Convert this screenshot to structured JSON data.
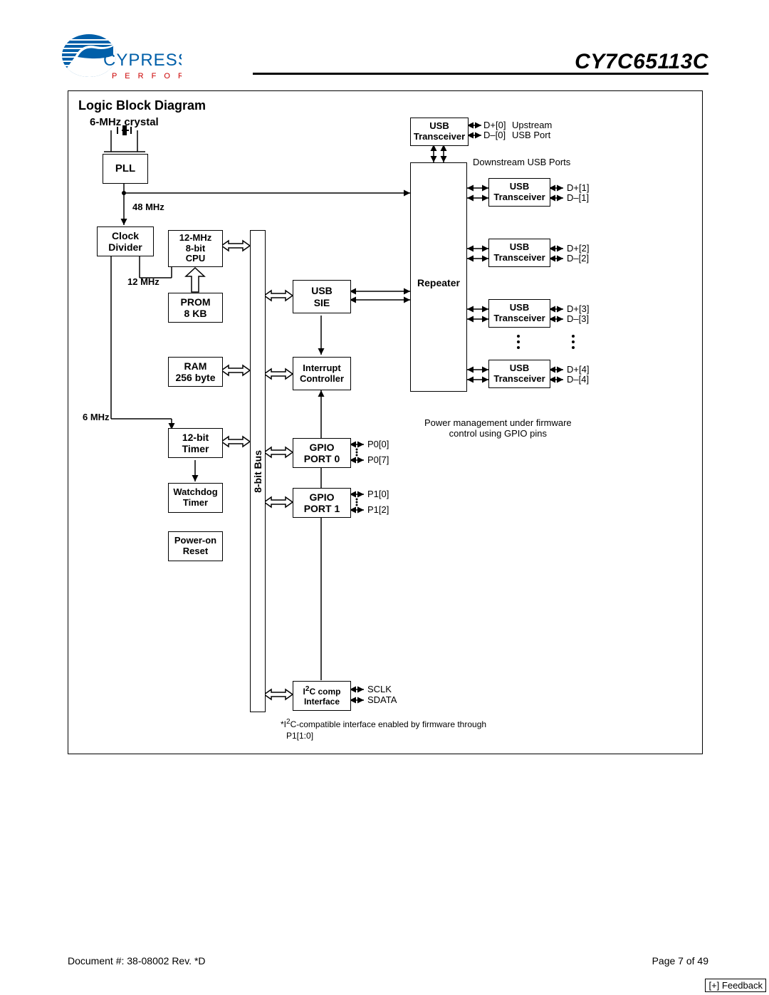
{
  "header": {
    "company": "CYPRESS",
    "tagline": "P E R F O R M",
    "part": "CY7C65113C"
  },
  "footer": {
    "doc": "Document #: 38-08002  Rev. *D",
    "page": "Page 7 of 49",
    "feedback": "[+] Feedback"
  },
  "diagram": {
    "title": "Logic Block Diagram",
    "blocks": {
      "crystal_label": "6-MHz crystal",
      "pll": "PLL",
      "clock48": "48 MHz",
      "clock_div": "Clock\nDivider",
      "clock12": "12 MHz",
      "cpu": "12-MHz\n8-bit\nCPU",
      "prom": "PROM\n8 KB",
      "ram": "RAM\n256 byte",
      "clock6": "6 MHz",
      "timer": "12-bit\nTimer",
      "wdt": "Watchdog\nTimer",
      "por": "Power-on\nReset",
      "bus": "8-bit Bus",
      "usb_sie": "USB\nSIE",
      "int_ctrl": "Interrupt\nController",
      "gpio0": "GPIO\nPORT 0",
      "gpio1": "GPIO\nPORT 1",
      "i2c": "I²C comp\nInterface",
      "repeater": "Repeater",
      "xcvr0": "USB\nTransceiver",
      "xcvr": "USB\nTransceiver",
      "i2c_note_a": "*I²C-compatible interface enabled by firmware through",
      "i2c_note_b": "P1[1:0]",
      "pm_note": "Power management under firmware\ncontrol using GPIO pins",
      "down_ports": "Downstream USB Ports"
    },
    "signals": {
      "p00": "P0[0]",
      "p07": "P0[7]",
      "p10": "P1[0]",
      "p12": "P1[2]",
      "sclk": "SCLK",
      "sdata": "SDATA",
      "d0p": "D+[0]",
      "d0m": "D–[0]",
      "up": "Upstream",
      "up2": "USB Port",
      "d1p": "D+[1]",
      "d1m": "D–[1]",
      "d2p": "D+[2]",
      "d2m": "D–[2]",
      "d3p": "D+[3]",
      "d3m": "D–[3]",
      "d4p": "D+[4]",
      "d4m": "D–[4]"
    }
  }
}
